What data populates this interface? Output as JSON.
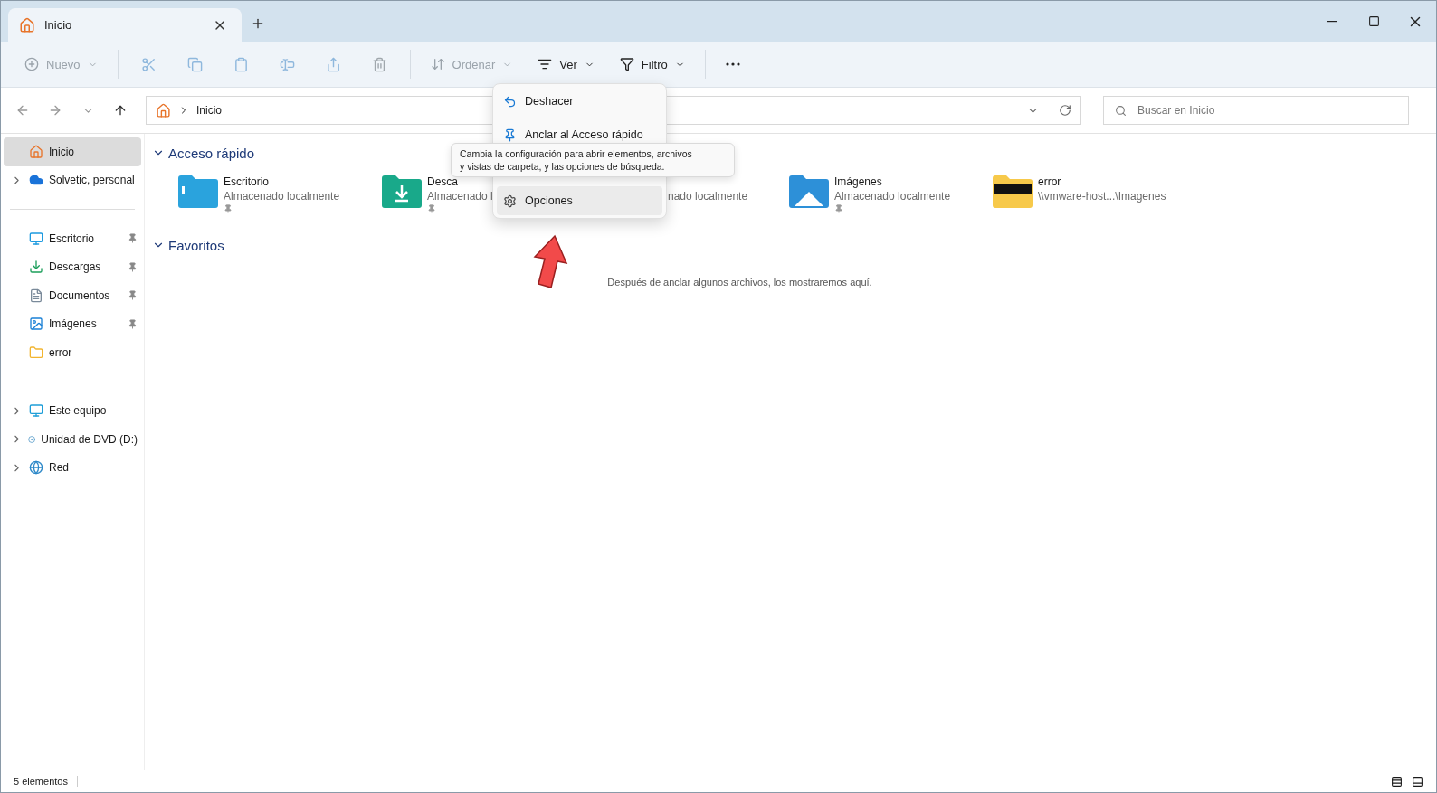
{
  "tabs": [
    {
      "label": "Inicio",
      "selected": true
    }
  ],
  "toolbar": {
    "new": {
      "label": "Nuevo",
      "disabled": true
    },
    "actions": [
      {
        "disabled": true
      },
      {
        "disabled": true
      },
      {
        "disabled": true
      },
      {
        "disabled": true
      },
      {
        "disabled": true
      },
      {
        "disabled": true
      }
    ],
    "sort": {
      "label": "Ordenar",
      "disabled": true
    },
    "view": {
      "label": "Ver",
      "disabled": false
    },
    "filter": {
      "label": "Filtro",
      "disabled": false
    }
  },
  "address": {
    "path": "Inicio"
  },
  "search": {
    "placeholder": "Buscar en Inicio"
  },
  "sidebar": {
    "groups": [
      [
        {
          "label": "Inicio",
          "selected": true,
          "expandable": false,
          "pinned": false
        },
        {
          "label": "Solvetic, personal",
          "selected": false,
          "expandable": true,
          "pinned": false
        }
      ],
      [
        {
          "label": "Escritorio",
          "selected": false,
          "expandable": false,
          "pinned": true
        },
        {
          "label": "Descargas",
          "selected": false,
          "expandable": false,
          "pinned": true
        },
        {
          "label": "Documentos",
          "selected": false,
          "expandable": false,
          "pinned": true
        },
        {
          "label": "Imágenes",
          "selected": false,
          "expandable": false,
          "pinned": true
        },
        {
          "label": "error",
          "selected": false,
          "expandable": false,
          "pinned": false
        }
      ],
      [
        {
          "label": "Este equipo",
          "selected": false,
          "expandable": true,
          "pinned": false
        },
        {
          "label": "Unidad de DVD (D:)",
          "selected": false,
          "expandable": true,
          "pinned": false
        },
        {
          "label": "Red",
          "selected": false,
          "expandable": true,
          "pinned": false
        }
      ]
    ]
  },
  "quick_access": {
    "title": "Acceso rápido",
    "expanded": true,
    "items": [
      {
        "kind": "desktop",
        "name": "Escritorio",
        "detail": "Almacenado localmente",
        "pinned": true
      },
      {
        "kind": "downloads",
        "name": "Desca",
        "detail": "Almacenado l",
        "pinned": true
      },
      {
        "kind": "covered",
        "detail": "nado localmente"
      },
      {
        "kind": "pictures",
        "name": "Imágenes",
        "detail": "Almacenado localmente",
        "pinned": true
      },
      {
        "kind": "folder",
        "name": "error",
        "detail": "\\\\vmware-host...\\Imagenes",
        "pinned": false
      }
    ]
  },
  "favorites": {
    "title": "Favoritos",
    "expanded": true,
    "empty_text": "Después de anclar algunos archivos, los mostraremos aquí."
  },
  "menu": {
    "items": [
      {
        "label": "Deshacer",
        "selected": false
      },
      {
        "label": "Anclar al Acceso rápido",
        "selected": false
      },
      {
        "label": "Opciones",
        "selected": true
      }
    ]
  },
  "tooltip": {
    "lines": [
      "Cambia la configuración para abrir elementos, archivos",
      "y vistas de carpeta, y las opciones de búsqueda."
    ]
  },
  "status_bar": {
    "count": "5 elementos"
  }
}
